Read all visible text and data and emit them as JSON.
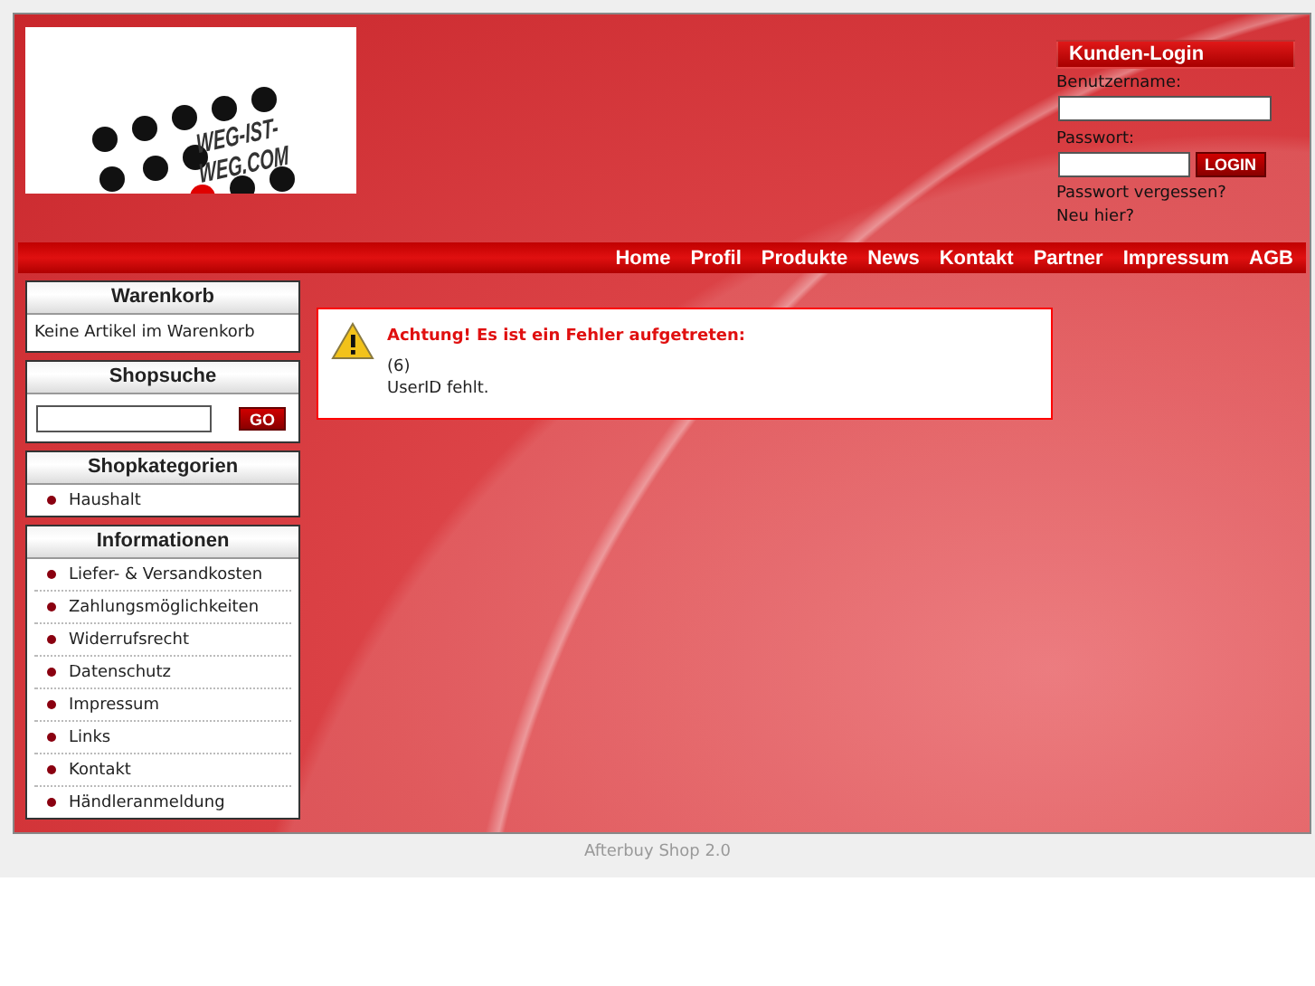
{
  "logo": {
    "text": "WEG-IST-WEG.COM"
  },
  "login": {
    "title": "Kunden-Login",
    "username_label": "Benutzername:",
    "password_label": "Passwort:",
    "button": "LOGIN",
    "links": [
      "Passwort vergessen?",
      "Neu hier?"
    ]
  },
  "nav": [
    "Home",
    "Profil",
    "Produkte",
    "News",
    "Kontakt",
    "Partner",
    "Impressum",
    "AGB"
  ],
  "sidebar": [
    {
      "kind": "text",
      "title": "Warenkorb",
      "text": "Keine Artikel im Warenkorb"
    },
    {
      "kind": "search",
      "title": "Shopsuche",
      "button": "GO"
    },
    {
      "kind": "list",
      "title": "Shopkategorien",
      "items": [
        "Haushalt"
      ]
    },
    {
      "kind": "list",
      "title": "Informationen",
      "items": [
        "Liefer- & Versandkosten",
        "Zahlungsmöglichkeiten",
        "Widerrufsrecht",
        "Datenschutz",
        "Impressum",
        "Links",
        "Kontakt",
        "Händleranmeldung"
      ]
    }
  ],
  "error": {
    "title": "Achtung! Es ist ein Fehler aufgetreten:",
    "lines": [
      "(6)",
      "UserID fehlt."
    ]
  },
  "footer": "Afterbuy Shop 2.0"
}
